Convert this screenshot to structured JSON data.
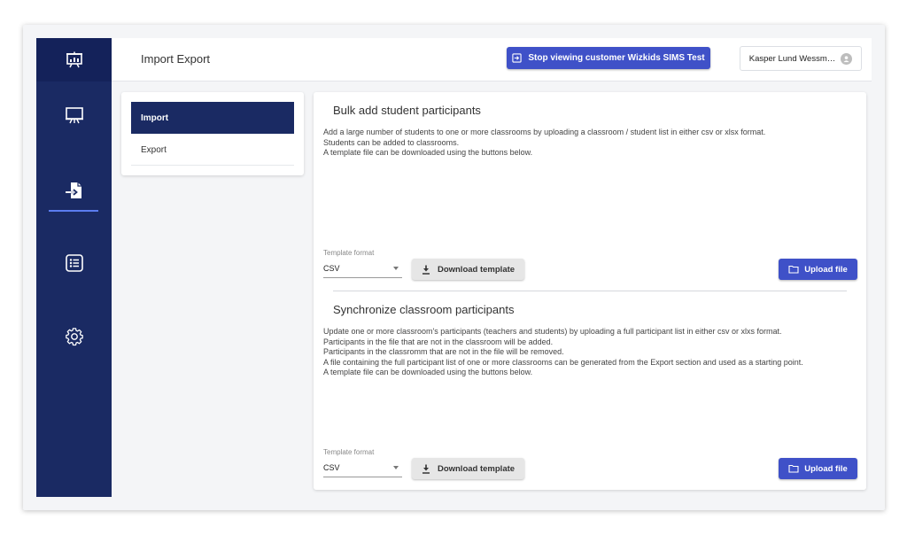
{
  "header": {
    "title": "Import Export",
    "stop_viewing_label": "Stop viewing customer Wizkids SIMS Test",
    "user_label": "Kasper Lund Wessm…"
  },
  "rail": {
    "items": [
      {
        "icon": "presentation-icon",
        "active": false
      },
      {
        "icon": "import-export-icon",
        "active": true
      },
      {
        "icon": "list-icon",
        "active": false
      },
      {
        "icon": "gear-icon",
        "active": false
      }
    ]
  },
  "tabs": [
    {
      "label": "Import",
      "active": true
    },
    {
      "label": "Export",
      "active": false
    }
  ],
  "sections": [
    {
      "title": "Bulk add student participants",
      "description": [
        "Add a large number of students to one or more classrooms by uploading a classroom / student list in either csv or xlsx format.",
        "Students can be added to classrooms.",
        "A template file can be downloaded using the buttons below."
      ],
      "template_format_label": "Template format",
      "template_format_value": "CSV",
      "download_label": "Download template",
      "upload_label": "Upload file"
    },
    {
      "title": "Synchronize classroom participants",
      "description": [
        "Update one or more classroom's participants (teachers and students) by uploading a full participant list in either csv or xlxs format.",
        "Participants in the file that are not in the classroom will be added.",
        "Participants in the classromm that are not in the file will be removed.",
        "A file containing the full participant list of one or more classrooms can be generated from the Export section and used as a starting point.",
        "A template file can be downloaded using the buttons below."
      ],
      "template_format_label": "Template format",
      "template_format_value": "CSV",
      "download_label": "Download template",
      "upload_label": "Upload file"
    }
  ],
  "colors": {
    "rail": "#1a2a63",
    "primary": "#3f51c8",
    "rail_active_indicator": "#5b7cf0"
  }
}
